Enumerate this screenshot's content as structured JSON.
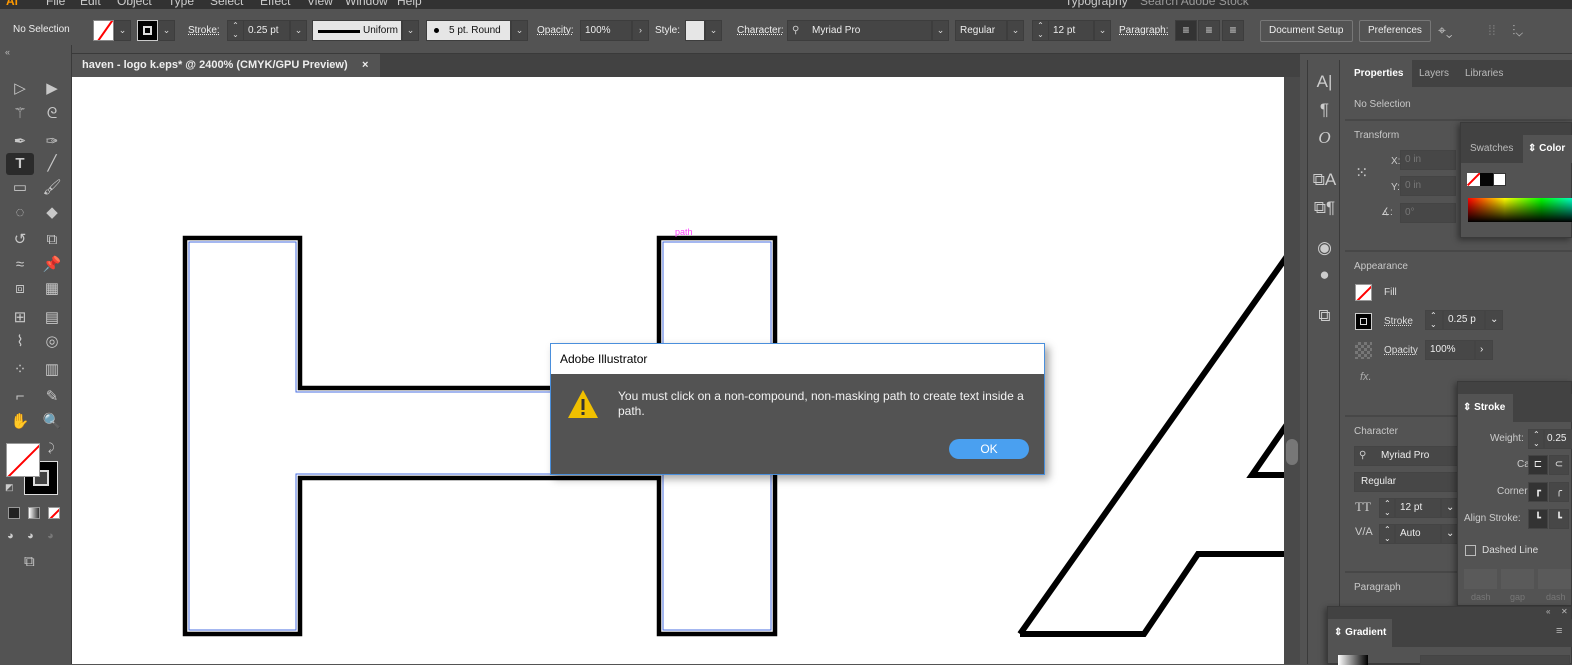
{
  "menu": [
    "Ai",
    "File",
    "Edit",
    "Object",
    "Type",
    "Select",
    "Effect",
    "View",
    "Window",
    "Help"
  ],
  "workspace": "Typography",
  "stock_search_placeholder": "Search Adobe Stock",
  "control": {
    "selection": "No Selection",
    "stroke_label": "Stroke:",
    "stroke_weight": "0.25 pt",
    "profile": "Uniform",
    "brush": "5 pt. Round",
    "opacity_label": "Opacity:",
    "opacity": "100%",
    "style_label": "Style:",
    "character_label": "Character:",
    "font": "Myriad Pro",
    "font_style": "Regular",
    "font_size": "12 pt",
    "paragraph_label": "Paragraph:",
    "document_setup": "Document Setup",
    "preferences": "Preferences"
  },
  "document_tab": {
    "title": "haven - logo k.eps* @ 2400% (CMYK/GPU Preview)",
    "close": "×"
  },
  "canvas": {
    "path_label": "path"
  },
  "dialog": {
    "title": "Adobe Illustrator",
    "message": "You must click on a non-compound, non-masking path to create text inside a path.",
    "ok": "OK",
    "icon": "warning-icon"
  },
  "properties": {
    "tabs": [
      "Properties",
      "Layers",
      "Libraries"
    ],
    "selection": "No Selection",
    "transform": {
      "title": "Transform",
      "x_label": "X:",
      "x": "0 in",
      "y_label": "Y:",
      "y": "0 in",
      "angle_label": ":",
      "angle": "0°"
    },
    "appearance": {
      "title": "Appearance",
      "fill": "Fill",
      "stroke": "Stroke",
      "stroke_weight": "0.25 p",
      "opacity": "Opacity",
      "opacity_value": "100%",
      "fx": "fx."
    },
    "character": {
      "title": "Character",
      "font": "Myriad Pro",
      "style": "Regular",
      "size": "12 pt",
      "tracking": "Auto"
    },
    "paragraph": {
      "title": "Paragraph"
    }
  },
  "color_panel": {
    "tabs": [
      "Swatches",
      "Color"
    ]
  },
  "stroke_panel": {
    "title": "Stroke",
    "weight_label": "Weight:",
    "weight": "0.25",
    "cap_label": "Cap:",
    "corner_label": "Corner:",
    "align_label": "Align Stroke:",
    "dashed": "Dashed Line",
    "dash_labels": [
      "dash",
      "gap",
      "dash"
    ]
  },
  "gradient_panel": {
    "title": "Gradient"
  },
  "colors": {
    "accent": "#4aa0f0",
    "warning": "#f0c000",
    "path_label": "#ff44ff",
    "selection_blue": "#4a6fe0"
  }
}
